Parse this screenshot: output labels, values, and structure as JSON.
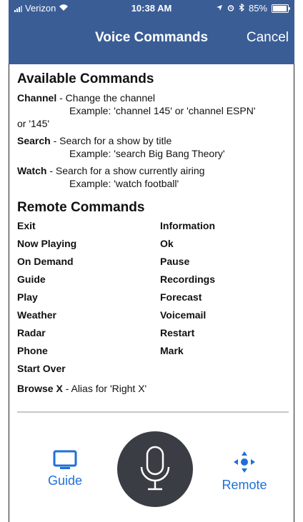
{
  "status_bar": {
    "carrier": "Verizon",
    "time": "10:38 AM",
    "battery": "85%",
    "battery_level": 0.85
  },
  "nav": {
    "title": "Voice Commands",
    "cancel_label": "Cancel"
  },
  "available": {
    "heading": "Available Commands",
    "commands": [
      {
        "name": "Channel",
        "desc": " - Change the channel",
        "example": "Example: 'channel 145' or 'channel ESPN'",
        "extra": "or '145'"
      },
      {
        "name": "Search",
        "desc": " - Search for a show by title",
        "example": "Example: 'search Big Bang Theory'"
      },
      {
        "name": "Watch",
        "desc": " - Search for a show currently airing",
        "example": "Example: 'watch football'"
      }
    ]
  },
  "remote": {
    "heading": "Remote Commands",
    "left": [
      "Exit",
      "Now Playing",
      "On Demand",
      "Guide",
      "Play",
      "Weather",
      "Radar",
      "Phone",
      "Start Over"
    ],
    "right": [
      "Information",
      "Ok",
      "Pause",
      "Recordings",
      "Forecast",
      "Voicemail",
      "Restart",
      "Mark"
    ],
    "browse_name": "Browse X",
    "browse_desc": " - Alias for 'Right X'"
  },
  "tabs": {
    "guide_label": "Guide",
    "remote_label": "Remote",
    "accent": "#1f6fd9"
  },
  "icons": {
    "guide": "tv-icon",
    "remote": "dpad-icon",
    "mic": "microphone-icon",
    "wifi": "wifi-icon",
    "location": "location-arrow-icon",
    "alarm": "alarm-icon",
    "bluetooth": "bluetooth-icon"
  }
}
